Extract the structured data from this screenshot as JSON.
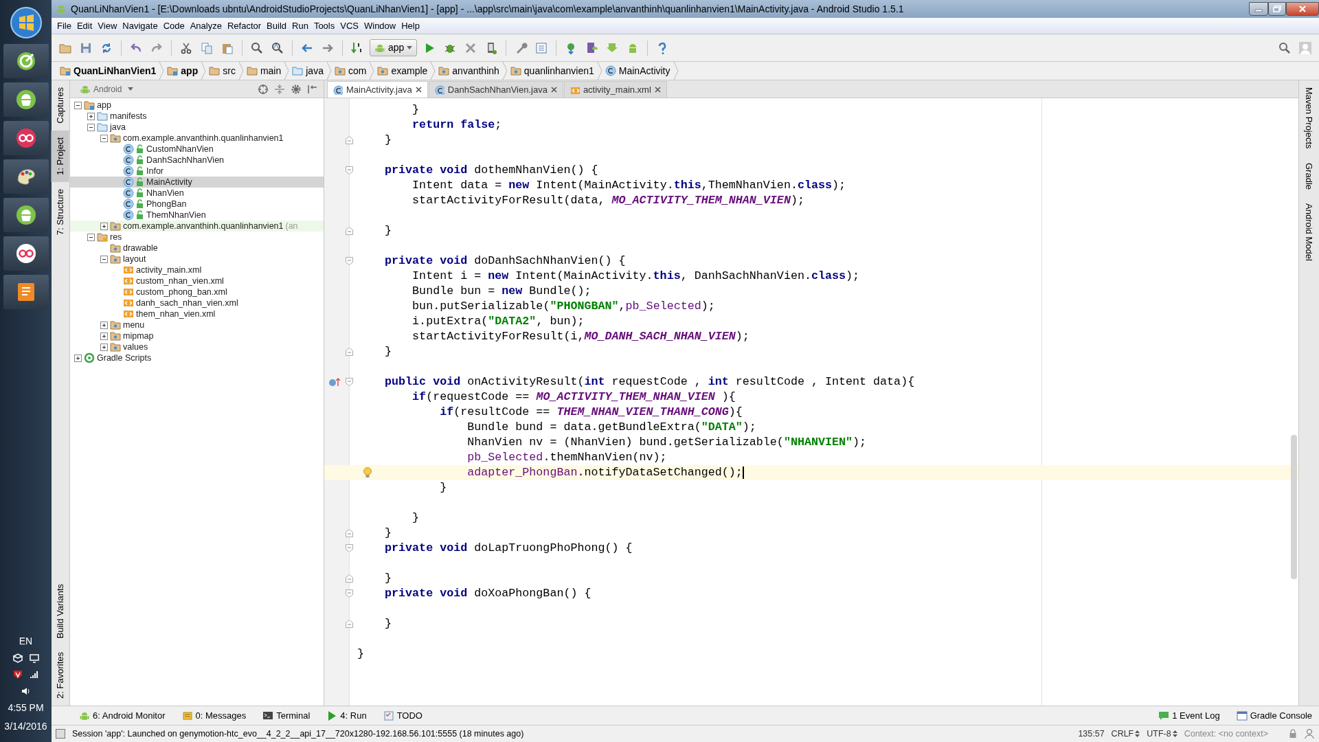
{
  "taskbar": {
    "language": "EN",
    "time": "4:55 PM",
    "date": "3/14/2016"
  },
  "window": {
    "title": "QuanLiNhanVien1 - [E:\\Downloads ubntu\\AndroidStudioProjects\\QuanLiNhanVien1] - [app] - ...\\app\\src\\main\\java\\com\\example\\anvanthinh\\quanlinhanvien1\\MainActivity.java - Android Studio 1.5.1"
  },
  "menu": [
    "File",
    "Edit",
    "View",
    "Navigate",
    "Code",
    "Analyze",
    "Refactor",
    "Build",
    "Run",
    "Tools",
    "VCS",
    "Window",
    "Help"
  ],
  "toolbar": {
    "run_config": "app"
  },
  "breadcrumbs": [
    {
      "label": "QuanLiNhanVien1",
      "kind": "project"
    },
    {
      "label": "app",
      "kind": "module"
    },
    {
      "label": "src",
      "kind": "folder"
    },
    {
      "label": "main",
      "kind": "folder"
    },
    {
      "label": "java",
      "kind": "source"
    },
    {
      "label": "com",
      "kind": "package"
    },
    {
      "label": "example",
      "kind": "package"
    },
    {
      "label": "anvanthinh",
      "kind": "package"
    },
    {
      "label": "quanlinhanvien1",
      "kind": "package"
    },
    {
      "label": "MainActivity",
      "kind": "class"
    }
  ],
  "left_tool_tabs": {
    "top": [
      {
        "label": "Captures",
        "selected": false
      },
      {
        "label": "1: Project",
        "selected": true
      },
      {
        "label": "7: Structure",
        "selected": false
      }
    ],
    "bottom": [
      {
        "label": "Build Variants",
        "selected": false
      },
      {
        "label": "2: Favorites",
        "selected": false
      }
    ]
  },
  "right_tool_tabs": [
    "Maven Projects",
    "Gradle",
    "Android Model"
  ],
  "project": {
    "view": "Android",
    "tree": [
      {
        "label": "app",
        "kind": "module",
        "expanded": true,
        "selected": false,
        "children": [
          {
            "label": "manifests",
            "kind": "source",
            "expanded": false,
            "selected": false
          },
          {
            "label": "java",
            "kind": "source",
            "expanded": true,
            "selected": false,
            "children": [
              {
                "label": "com.example.anvanthinh.quanlinhanvien1",
                "kind": "package",
                "expanded": true,
                "selected": false,
                "children": [
                  {
                    "label": "CustomNhanVien",
                    "kind": "class",
                    "selected": false
                  },
                  {
                    "label": "DanhSachNhanVien",
                    "kind": "class",
                    "selected": false
                  },
                  {
                    "label": "Infor",
                    "kind": "class",
                    "selected": false
                  },
                  {
                    "label": "MainActivity",
                    "kind": "class",
                    "selected": true
                  },
                  {
                    "label": "NhanVien",
                    "kind": "class",
                    "selected": false
                  },
                  {
                    "label": "PhongBan",
                    "kind": "class",
                    "selected": false
                  },
                  {
                    "label": "ThemNhanVien",
                    "kind": "class",
                    "selected": false
                  }
                ]
              },
              {
                "label": "com.example.anvanthinh.quanlinhanvien1",
                "suffix": "(an",
                "kind": "test_package",
                "expanded": false,
                "selected": false
              }
            ]
          },
          {
            "label": "res",
            "kind": "res",
            "expanded": true,
            "selected": false,
            "children": [
              {
                "label": "drawable",
                "kind": "package",
                "selected": false
              },
              {
                "label": "layout",
                "kind": "package",
                "expanded": true,
                "selected": false,
                "children": [
                  {
                    "label": "activity_main.xml",
                    "kind": "xml",
                    "selected": false
                  },
                  {
                    "label": "custom_nhan_vien.xml",
                    "kind": "xml",
                    "selected": false
                  },
                  {
                    "label": "custom_phong_ban.xml",
                    "kind": "xml",
                    "selected": false
                  },
                  {
                    "label": "danh_sach_nhan_vien.xml",
                    "kind": "xml",
                    "selected": false
                  },
                  {
                    "label": "them_nhan_vien.xml",
                    "kind": "xml",
                    "selected": false
                  }
                ]
              },
              {
                "label": "menu",
                "kind": "package",
                "expanded": false,
                "selected": false
              },
              {
                "label": "mipmap",
                "kind": "package",
                "expanded": false,
                "selected": false
              },
              {
                "label": "values",
                "kind": "package",
                "expanded": false,
                "selected": false
              }
            ]
          }
        ]
      },
      {
        "label": "Gradle Scripts",
        "kind": "gradle",
        "expanded": false,
        "selected": false
      }
    ]
  },
  "editor_tabs": [
    {
      "label": "MainActivity.java",
      "kind": "class",
      "selected": true
    },
    {
      "label": "DanhSachNhanVien.java",
      "kind": "class",
      "selected": false
    },
    {
      "label": "activity_main.xml",
      "kind": "xml",
      "selected": false
    }
  ],
  "code": [
    {
      "kind": "plain",
      "current": false,
      "tokens": [
        {
          "kind": "plain",
          "text": "        }"
        }
      ]
    },
    {
      "kind": "plain",
      "current": false,
      "tokens": [
        {
          "kind": "keyword",
          "text": "        return false"
        },
        {
          "kind": "plain",
          "text": ";"
        }
      ]
    },
    {
      "kind": "block_end",
      "current": false,
      "tokens": [
        {
          "kind": "plain",
          "text": "    }"
        }
      ]
    },
    {
      "kind": "plain",
      "current": false
    },
    {
      "kind": "block_start",
      "current": false,
      "tokens": [
        {
          "kind": "keyword",
          "text": "    private void"
        },
        {
          "kind": "plain",
          "text": " dothemNhanVien() {"
        }
      ]
    },
    {
      "kind": "plain",
      "current": false,
      "tokens": [
        {
          "kind": "plain",
          "text": "        Intent data = "
        },
        {
          "kind": "keyword",
          "text": "new"
        },
        {
          "kind": "plain",
          "text": " Intent(MainActivity."
        },
        {
          "kind": "keyword",
          "text": "this"
        },
        {
          "kind": "plain",
          "text": ",ThemNhanVien."
        },
        {
          "kind": "keyword",
          "text": "class"
        },
        {
          "kind": "plain",
          "text": ");"
        }
      ]
    },
    {
      "kind": "plain",
      "current": false,
      "tokens": [
        {
          "kind": "plain",
          "text": "        startActivityForResult(data, "
        },
        {
          "kind": "constant",
          "text": "MO_ACTIVITY_THEM_NHAN_VIEN"
        },
        {
          "kind": "plain",
          "text": ");"
        }
      ]
    },
    {
      "kind": "plain",
      "current": false
    },
    {
      "kind": "block_end",
      "current": false,
      "tokens": [
        {
          "kind": "plain",
          "text": "    }"
        }
      ]
    },
    {
      "kind": "plain",
      "current": false
    },
    {
      "kind": "block_start",
      "current": false,
      "tokens": [
        {
          "kind": "keyword",
          "text": "    private void"
        },
        {
          "kind": "plain",
          "text": " doDanhSachNhanVien() {"
        }
      ]
    },
    {
      "kind": "plain",
      "current": false,
      "tokens": [
        {
          "kind": "plain",
          "text": "        Intent i = "
        },
        {
          "kind": "keyword",
          "text": "new"
        },
        {
          "kind": "plain",
          "text": " Intent(MainActivity."
        },
        {
          "kind": "keyword",
          "text": "this"
        },
        {
          "kind": "plain",
          "text": ", DanhSachNhanVien."
        },
        {
          "kind": "keyword",
          "text": "class"
        },
        {
          "kind": "plain",
          "text": ");"
        }
      ]
    },
    {
      "kind": "plain",
      "current": false,
      "tokens": [
        {
          "kind": "plain",
          "text": "        Bundle bun = "
        },
        {
          "kind": "keyword",
          "text": "new"
        },
        {
          "kind": "plain",
          "text": " Bundle();"
        }
      ]
    },
    {
      "kind": "plain",
      "current": false,
      "tokens": [
        {
          "kind": "plain",
          "text": "        bun.putSerializable("
        },
        {
          "kind": "string",
          "text": "\"PHONGBAN\""
        },
        {
          "kind": "plain",
          "text": ","
        },
        {
          "kind": "field",
          "text": "pb_Selected"
        },
        {
          "kind": "plain",
          "text": ");"
        }
      ]
    },
    {
      "kind": "plain",
      "current": false,
      "tokens": [
        {
          "kind": "plain",
          "text": "        i.putExtra("
        },
        {
          "kind": "string",
          "text": "\"DATA2\""
        },
        {
          "kind": "plain",
          "text": ", bun);"
        }
      ]
    },
    {
      "kind": "plain",
      "current": false,
      "tokens": [
        {
          "kind": "plain",
          "text": "        startActivityForResult(i,"
        },
        {
          "kind": "constant",
          "text": "MO_DANH_SACH_NHAN_VIEN"
        },
        {
          "kind": "plain",
          "text": ");"
        }
      ]
    },
    {
      "kind": "block_end",
      "current": false,
      "tokens": [
        {
          "kind": "plain",
          "text": "    }"
        }
      ]
    },
    {
      "kind": "plain",
      "current": false
    },
    {
      "kind": "override_start",
      "current": false,
      "tokens": [
        {
          "kind": "keyword",
          "text": "    public void"
        },
        {
          "kind": "plain",
          "text": " onActivityResult("
        },
        {
          "kind": "keyword",
          "text": "int"
        },
        {
          "kind": "plain",
          "text": " requestCode , "
        },
        {
          "kind": "keyword",
          "text": "int"
        },
        {
          "kind": "plain",
          "text": " resultCode , Intent data){"
        }
      ]
    },
    {
      "kind": "plain",
      "current": false,
      "tokens": [
        {
          "kind": "keyword",
          "text": "        if"
        },
        {
          "kind": "plain",
          "text": "(requestCode == "
        },
        {
          "kind": "constant",
          "text": "MO_ACTIVITY_THEM_NHAN_VIEN"
        },
        {
          "kind": "plain",
          "text": " ){"
        }
      ]
    },
    {
      "kind": "plain",
      "current": false,
      "tokens": [
        {
          "kind": "keyword",
          "text": "            if"
        },
        {
          "kind": "plain",
          "text": "(resultCode == "
        },
        {
          "kind": "constant",
          "text": "THEM_NHAN_VIEN_THANH_CONG"
        },
        {
          "kind": "plain",
          "text": "){"
        }
      ]
    },
    {
      "kind": "plain",
      "current": false,
      "tokens": [
        {
          "kind": "plain",
          "text": "                Bundle bund = data.getBundleExtra("
        },
        {
          "kind": "string",
          "text": "\"DATA\""
        },
        {
          "kind": "plain",
          "text": ");"
        }
      ]
    },
    {
      "kind": "plain",
      "current": false,
      "tokens": [
        {
          "kind": "plain",
          "text": "                NhanVien nv = (NhanVien) bund.getSerializable("
        },
        {
          "kind": "string",
          "text": "\"NHANVIEN\""
        },
        {
          "kind": "plain",
          "text": ");"
        }
      ]
    },
    {
      "kind": "plain",
      "current": false,
      "tokens": [
        {
          "kind": "field",
          "text": "                pb_Selected"
        },
        {
          "kind": "plain",
          "text": ".themNhanVien(nv);"
        }
      ]
    },
    {
      "kind": "hint",
      "current": true,
      "tokens": [
        {
          "kind": "field",
          "text": "                adapter_PhongBan"
        },
        {
          "kind": "plain",
          "text": ".notifyDataSetChanged();"
        }
      ]
    },
    {
      "kind": "plain",
      "current": false,
      "tokens": [
        {
          "kind": "plain",
          "text": "            }"
        }
      ]
    },
    {
      "kind": "plain",
      "current": false
    },
    {
      "kind": "plain",
      "current": false,
      "tokens": [
        {
          "kind": "plain",
          "text": "        }"
        }
      ]
    },
    {
      "kind": "block_end",
      "current": false,
      "tokens": [
        {
          "kind": "plain",
          "text": "    }"
        }
      ]
    },
    {
      "kind": "block_start",
      "current": false,
      "tokens": [
        {
          "kind": "keyword",
          "text": "    private void"
        },
        {
          "kind": "plain",
          "text": " doLapTruongPhoPhong() {"
        }
      ]
    },
    {
      "kind": "plain",
      "current": false
    },
    {
      "kind": "block_end",
      "current": false,
      "tokens": [
        {
          "kind": "plain",
          "text": "    }"
        }
      ]
    },
    {
      "kind": "block_start",
      "current": false,
      "tokens": [
        {
          "kind": "keyword",
          "text": "    private void"
        },
        {
          "kind": "plain",
          "text": " doXoaPhongBan() {"
        }
      ]
    },
    {
      "kind": "plain",
      "current": false
    },
    {
      "kind": "block_end",
      "current": false,
      "tokens": [
        {
          "kind": "plain",
          "text": "    }"
        }
      ]
    },
    {
      "kind": "plain",
      "current": false
    },
    {
      "kind": "plain",
      "current": false,
      "tokens": [
        {
          "kind": "plain",
          "text": "}"
        }
      ]
    }
  ],
  "tool_windows": {
    "left": [
      {
        "label": "6: Android Monitor",
        "kind": "android"
      },
      {
        "label": "0: Messages",
        "kind": "messages"
      },
      {
        "label": "Terminal",
        "kind": "terminal"
      },
      {
        "label": "4: Run",
        "kind": "run"
      },
      {
        "label": "TODO",
        "kind": "todo"
      }
    ],
    "right": [
      {
        "label": "1 Event Log",
        "kind": "log"
      },
      {
        "label": "Gradle Console",
        "kind": "console"
      }
    ]
  },
  "status_bar": {
    "message": "Session 'app': Launched on genymotion-htc_evo__4_2_2__api_17__720x1280-192.168.56.101:5555 (18 minutes ago)",
    "position": "135:57",
    "line_separator": "CRLF",
    "encoding": "UTF-8",
    "context": "Context: <no context>"
  }
}
